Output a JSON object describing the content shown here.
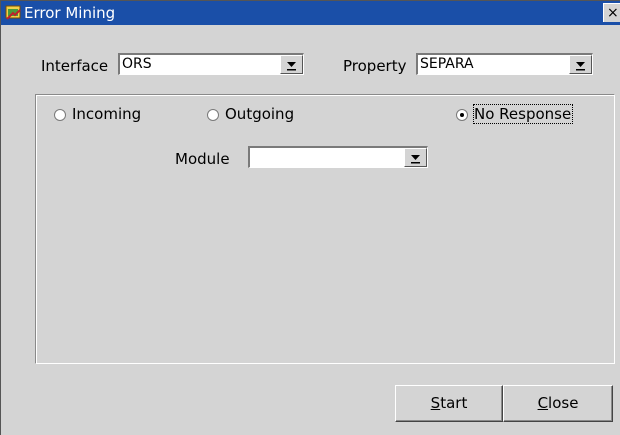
{
  "window": {
    "title": "Error Mining",
    "icon": "app-window-icon",
    "close_glyph": "×"
  },
  "filters": {
    "interface_label": "Interface",
    "interface_value": "ORS",
    "property_label": "Property",
    "property_value": "SEPARA"
  },
  "direction": {
    "options": [
      {
        "label": "Incoming",
        "selected": false
      },
      {
        "label": "Outgoing",
        "selected": false
      },
      {
        "label": "No Response",
        "selected": true
      }
    ]
  },
  "module": {
    "label": "Module",
    "value": ""
  },
  "buttons": {
    "start_mnemonic": "S",
    "start_rest": "tart",
    "close_mnemonic": "C",
    "close_rest": "lose"
  },
  "colors": {
    "titlebar": "#1a4fa8",
    "window_bg": "#d4d4d4"
  }
}
